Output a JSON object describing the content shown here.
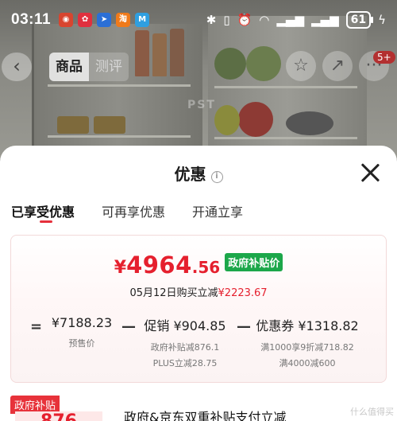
{
  "status_bar": {
    "time": "03:11",
    "battery": "61",
    "app_icons": [
      "weibo-icon",
      "xiaohongshu-icon",
      "pointer-app-icon",
      "taobao-icon",
      "store-app-icon"
    ]
  },
  "background_page": {
    "tabs": [
      "商品",
      "测评"
    ],
    "cart_badge": "5+",
    "watermark": "PST"
  },
  "sheet": {
    "title": "优惠",
    "tabs": [
      {
        "label": "已享受优惠",
        "active": true
      },
      {
        "label": "可再享优惠",
        "active": false
      },
      {
        "label": "开通立享",
        "active": false
      }
    ],
    "price": {
      "currency": "¥",
      "integer": "4964",
      "decimal": ".56",
      "badge": "政府补贴价"
    },
    "save_line": {
      "prefix": "05月12日购买立减",
      "amount": "¥2223.67"
    },
    "breakdown": [
      {
        "op": "=",
        "value": "¥7188.23",
        "details": [
          "预售价"
        ]
      },
      {
        "op": "—",
        "value": "促销 ¥904.85",
        "details": [
          "政府补贴减876.1",
          "PLUS立减28.75"
        ]
      },
      {
        "op": "—",
        "value": "优惠券 ¥1318.82",
        "details": [
          "满1000享9折减718.82",
          "满4000减600"
        ]
      }
    ],
    "next_item": {
      "tag": "政府补贴",
      "amount": "876",
      "text": "政府&京东双重补贴支付立减"
    },
    "corner_watermark": "什么值得买"
  },
  "colors": {
    "accent_red": "#e5202e",
    "gov_green": "#1ca74a",
    "tab_underline": "#e5303c"
  }
}
